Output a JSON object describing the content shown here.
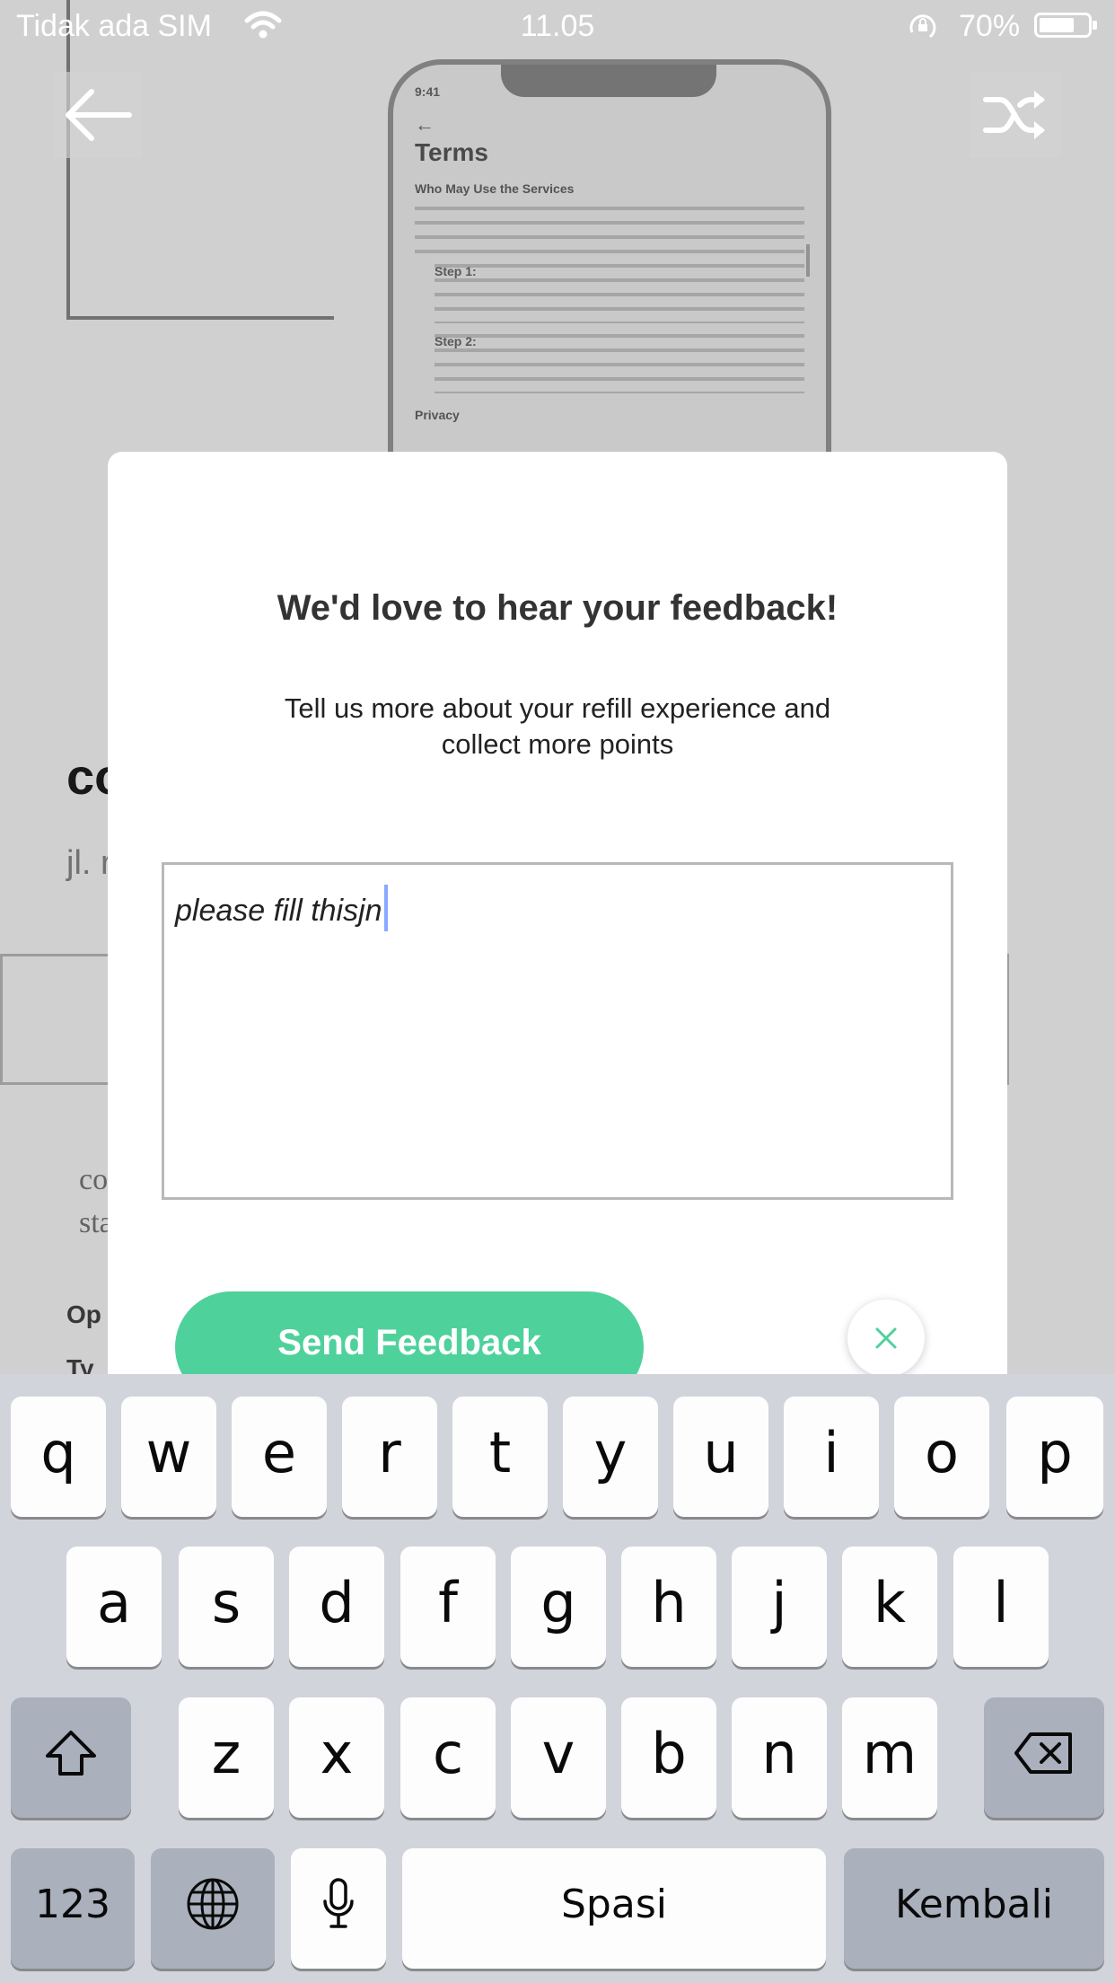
{
  "status_bar": {
    "carrier": "Tidak ada SIM",
    "time": "11.05",
    "battery": "70%",
    "battery_level": 0.7
  },
  "background": {
    "preview": {
      "time": "9:41",
      "title": "Terms",
      "section1": "Who May Use the Services",
      "step1": "Step 1:",
      "step2": "Step 2:",
      "section2": "Privacy"
    },
    "title_fragment": "co",
    "address_fragment": "jl. r",
    "desc_line1": "co",
    "desc_line2": "sta",
    "label1": "Op",
    "label2": "Ty"
  },
  "modal": {
    "title": "We'd love to hear your feedback!",
    "subtitle_line1": "Tell us more about your refill experience and",
    "subtitle_line2": "collect more points",
    "input_value": "please fill thisjn",
    "send_label": "Send Feedback"
  },
  "keyboard": {
    "row1": [
      "q",
      "w",
      "e",
      "r",
      "t",
      "y",
      "u",
      "i",
      "o",
      "p"
    ],
    "row2": [
      "a",
      "s",
      "d",
      "f",
      "g",
      "h",
      "j",
      "k",
      "l"
    ],
    "row3": [
      "z",
      "x",
      "c",
      "v",
      "b",
      "n",
      "m"
    ],
    "numbers_label": "123",
    "space_label": "Spasi",
    "return_label": "Kembali"
  },
  "colors": {
    "accent": "#4fd19c",
    "keyboard_bg": "#d1d4db",
    "function_key": "#aab0bc"
  },
  "icons": [
    "wifi-icon",
    "orientation-lock-icon",
    "battery-icon",
    "back-arrow-icon",
    "shuffle-icon",
    "close-icon",
    "shift-icon",
    "backspace-icon",
    "globe-icon",
    "microphone-icon"
  ]
}
